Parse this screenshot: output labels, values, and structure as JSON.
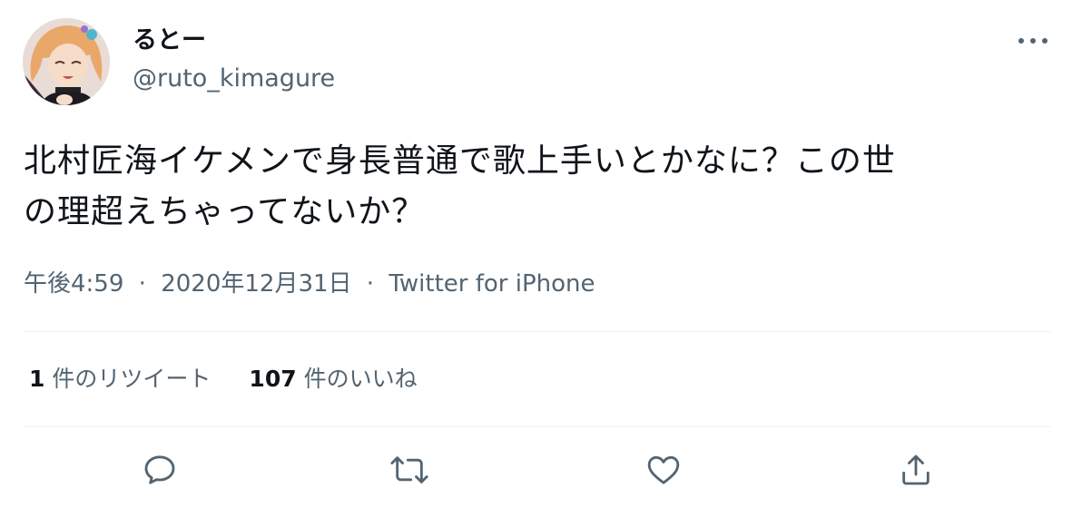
{
  "user": {
    "display_name": "るとー",
    "handle": "@ruto_kimagure"
  },
  "tweet": {
    "text_line1": "北村匠海イケメンで身長普通で歌上手いとかなに？この世",
    "text_line2": "の理超えちゃってないか？",
    "time": "午後4:59",
    "date": "2020年12月31日",
    "separator": "·",
    "source": "Twitter for iPhone"
  },
  "stats": {
    "retweets_count": "1",
    "retweets_label": "件のリツイート",
    "likes_count": "107",
    "likes_label": "件のいいね"
  },
  "icons": {
    "more": "more-icon",
    "reply": "reply-icon",
    "retweet": "retweet-icon",
    "like": "like-icon",
    "share": "share-icon"
  },
  "colors": {
    "text": "#0f1419",
    "secondary": "#536471",
    "divider": "#eff3f4"
  }
}
